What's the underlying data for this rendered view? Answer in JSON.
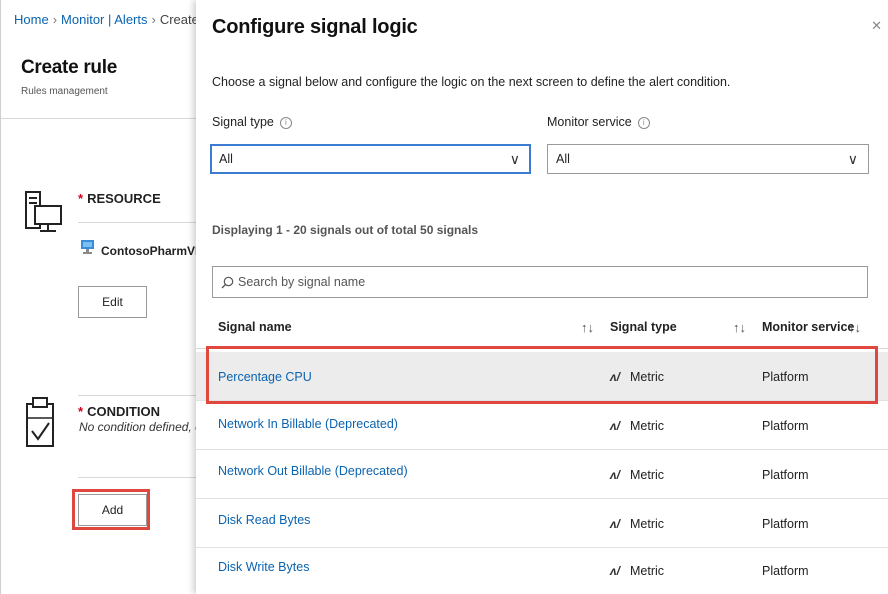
{
  "breadcrumb": {
    "home": "Home",
    "monitor": "Monitor | Alerts",
    "current": "Create rule"
  },
  "create_rule": {
    "title": "Create rule",
    "subtitle": "Rules management",
    "resource_label": "RESOURCE",
    "resource_name": "ContosoPharmVM",
    "edit_label": "Edit",
    "condition_label": "CONDITION",
    "no_condition_text": "No condition defined, click on 'Add' to select a signal and define its logic",
    "add_label": "Add"
  },
  "panel": {
    "title": "Configure signal logic",
    "close_icon": "close-icon",
    "intro": "Choose a signal below and configure the logic on the next screen to define the alert condition.",
    "signal_type_label": "Signal type",
    "signal_type_value": "All",
    "monitor_service_label": "Monitor service",
    "monitor_service_value": "All",
    "displaying_text": "Displaying 1 - 20 signals out of total 50 signals",
    "search_placeholder": "Search by signal name",
    "columns": [
      "Signal name",
      "Signal type",
      "Monitor service"
    ],
    "rows": [
      {
        "name": "Percentage CPU",
        "type": "Metric",
        "service": "Platform"
      },
      {
        "name": "Network In Billable (Deprecated)",
        "type": "Metric",
        "service": "Platform"
      },
      {
        "name": "Network Out Billable (Deprecated)",
        "type": "Metric",
        "service": "Platform"
      },
      {
        "name": "Disk Read Bytes",
        "type": "Metric",
        "service": "Platform"
      },
      {
        "name": "Disk Write Bytes",
        "type": "Metric",
        "service": "Platform"
      }
    ]
  },
  "colors": {
    "link": "#0a63b0",
    "highlight": "#e0473e",
    "required_star": "#d0021b",
    "focus_border": "#3b7bd1"
  }
}
